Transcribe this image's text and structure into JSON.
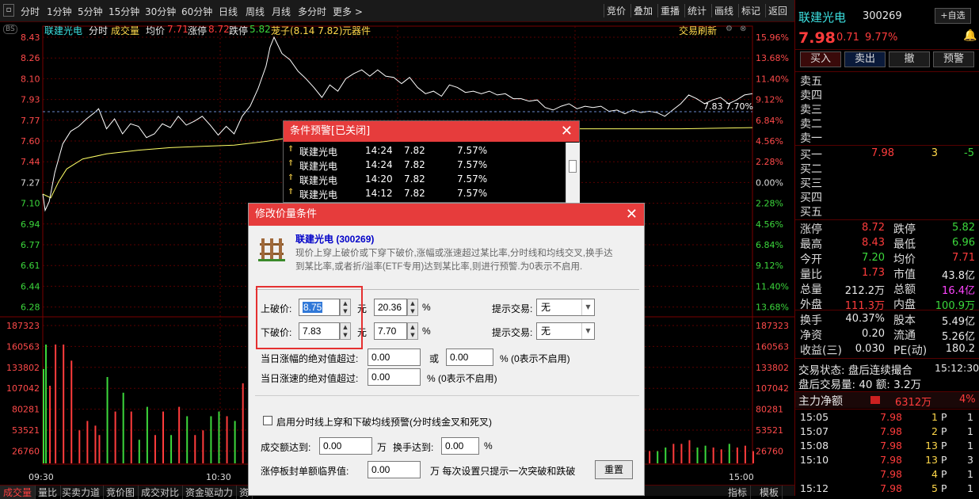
{
  "topbar": {
    "tabs": [
      "分时",
      "1分钟",
      "5分钟",
      "15分钟",
      "30分钟",
      "60分钟",
      "日线",
      "周线",
      "月线",
      "多分时",
      "更多 >"
    ],
    "active_tab": "分时",
    "right_buttons": [
      "竞价",
      "叠加",
      "重播",
      "统计",
      "画线",
      "标记",
      "返回"
    ]
  },
  "chart_header": {
    "name": "联建光电",
    "mode": "分时",
    "vol_label": "成交量",
    "avg_label": "均价",
    "avg_value": "7.71",
    "limit_up_label": "涨停",
    "limit_up": "8.72",
    "limit_down_label": "跌停",
    "limit_down": "5.82",
    "concept": "茏子(8.14 7.82)",
    "industry": "元器件",
    "refresh": "交易刷新"
  },
  "chart_data": {
    "type": "line",
    "price_ticks": [
      "8.43",
      "8.26",
      "8.10",
      "7.93",
      "7.77",
      "7.60",
      "7.44",
      "7.27",
      "7.10",
      "6.94",
      "6.77",
      "6.61",
      "6.44",
      "6.28"
    ],
    "pct_ticks": [
      "15.96%",
      "13.68%",
      "11.40%",
      "9.12%",
      "6.84%",
      "4.56%",
      "2.28%",
      "0.00%",
      "2.28%",
      "4.56%",
      "6.84%",
      "9.12%",
      "11.40%",
      "13.68%"
    ],
    "vol_ticks": [
      "187323",
      "160563",
      "133802",
      "107042",
      "80281",
      "53521",
      "26760"
    ],
    "time_ticks": [
      "09:30",
      "10:30",
      "15:00"
    ],
    "prev_close": 7.27,
    "alert_line_label": "7.83 7.70%",
    "series": [
      {
        "name": "分时",
        "color": "#ffffff",
        "points": [
          [
            0,
            7.18
          ],
          [
            3,
            7.05
          ],
          [
            8,
            7.12
          ],
          [
            15,
            7.35
          ],
          [
            25,
            7.58
          ],
          [
            35,
            7.68
          ],
          [
            45,
            7.72
          ],
          [
            55,
            7.78
          ],
          [
            65,
            7.83
          ],
          [
            70,
            7.86
          ],
          [
            80,
            7.7
          ],
          [
            90,
            7.78
          ],
          [
            100,
            7.66
          ],
          [
            110,
            7.74
          ],
          [
            120,
            7.72
          ],
          [
            130,
            7.63
          ],
          [
            140,
            7.66
          ],
          [
            150,
            7.74
          ],
          [
            160,
            7.71
          ],
          [
            170,
            7.8
          ],
          [
            180,
            7.73
          ],
          [
            190,
            7.76
          ],
          [
            200,
            7.8
          ],
          [
            210,
            7.73
          ],
          [
            220,
            7.65
          ],
          [
            230,
            7.72
          ],
          [
            240,
            7.66
          ],
          [
            250,
            7.8
          ],
          [
            260,
            7.88
          ],
          [
            270,
            8.02
          ],
          [
            280,
            8.2
          ],
          [
            285,
            8.35
          ],
          [
            290,
            8.43
          ],
          [
            300,
            8.3
          ],
          [
            310,
            8.25
          ],
          [
            320,
            8.16
          ],
          [
            330,
            8.1
          ],
          [
            340,
            8.03
          ],
          [
            350,
            7.95
          ],
          [
            360,
            8.05
          ],
          [
            370,
            8.0
          ],
          [
            380,
            8.1
          ],
          [
            390,
            8.14
          ],
          [
            400,
            8.17
          ],
          [
            410,
            8.12
          ],
          [
            420,
            8.17
          ],
          [
            430,
            8.12
          ],
          [
            440,
            8.11
          ],
          [
            450,
            8.06
          ],
          [
            460,
            8.11
          ],
          [
            470,
            8.03
          ],
          [
            480,
            7.98
          ],
          [
            490,
            8.0
          ],
          [
            500,
            7.96
          ],
          [
            510,
            8.05
          ],
          [
            520,
            8.03
          ],
          [
            530,
            7.99
          ],
          [
            540,
            8.0
          ],
          [
            550,
            7.98
          ],
          [
            560,
            8.0
          ],
          [
            570,
            7.97
          ],
          [
            580,
            7.98
          ],
          [
            590,
            7.94
          ],
          [
            600,
            7.94
          ],
          [
            610,
            7.92
          ],
          [
            620,
            7.93
          ],
          [
            630,
            7.87
          ],
          [
            640,
            7.85
          ],
          [
            650,
            7.88
          ],
          [
            660,
            7.9
          ],
          [
            670,
            7.86
          ],
          [
            680,
            7.88
          ],
          [
            690,
            7.87
          ],
          [
            700,
            7.88
          ],
          [
            710,
            7.84
          ],
          [
            720,
            7.85
          ],
          [
            730,
            7.82
          ],
          [
            740,
            7.85
          ],
          [
            750,
            7.83
          ],
          [
            760,
            7.84
          ],
          [
            770,
            7.83
          ],
          [
            780,
            7.8
          ],
          [
            790,
            7.85
          ],
          [
            800,
            7.9
          ],
          [
            810,
            7.97
          ],
          [
            820,
            7.94
          ],
          [
            830,
            7.9
          ],
          [
            840,
            7.93
          ],
          [
            850,
            7.95
          ],
          [
            860,
            7.9
          ],
          [
            870,
            7.93
          ],
          [
            880,
            7.97
          ],
          [
            890,
            7.98
          ]
        ]
      },
      {
        "name": "均价",
        "color": "#ffff66",
        "points": [
          [
            0,
            7.18
          ],
          [
            10,
            7.15
          ],
          [
            20,
            7.28
          ],
          [
            30,
            7.38
          ],
          [
            50,
            7.46
          ],
          [
            80,
            7.5
          ],
          [
            120,
            7.53
          ],
          [
            160,
            7.55
          ],
          [
            200,
            7.56
          ],
          [
            240,
            7.57
          ],
          [
            280,
            7.6
          ],
          [
            320,
            7.64
          ],
          [
            360,
            7.66
          ],
          [
            400,
            7.68
          ],
          [
            450,
            7.69
          ],
          [
            500,
            7.7
          ],
          [
            550,
            7.7
          ],
          [
            600,
            7.7
          ],
          [
            700,
            7.7
          ],
          [
            800,
            7.7
          ],
          [
            890,
            7.71
          ]
        ]
      }
    ]
  },
  "bottombar": {
    "tabs": [
      "成交量",
      "量比",
      "买卖力道",
      "竞价图",
      "成交对比",
      "资金驱动力",
      "资"
    ],
    "right": [
      "指标",
      "模板"
    ]
  },
  "quote": {
    "name": "联建光电",
    "code": "300269",
    "self_select": "+自选",
    "price": "7.98",
    "change": "0.71",
    "change_pct": "9.77%",
    "buttons": [
      "买入",
      "卖出",
      "撤",
      "预警"
    ],
    "sells": [
      "卖五",
      "卖四",
      "卖三",
      "卖二",
      "卖一"
    ],
    "buys": [
      {
        "label": "买一",
        "price": "7.98",
        "vol": "3",
        "diff": "-5"
      },
      {
        "label": "买二",
        "price": "",
        "vol": "",
        "diff": ""
      },
      {
        "label": "买三",
        "price": "",
        "vol": "",
        "diff": ""
      },
      {
        "label": "买四",
        "price": "",
        "vol": "",
        "diff": ""
      },
      {
        "label": "买五",
        "price": "",
        "vol": "",
        "diff": ""
      }
    ],
    "stats": [
      {
        "l1": "涨停",
        "v1": "8.72",
        "c1": "red",
        "l2": "跌停",
        "v2": "5.82",
        "c2": "grn"
      },
      {
        "l1": "最高",
        "v1": "8.43",
        "c1": "red",
        "l2": "最低",
        "v2": "6.96",
        "c2": "grn"
      },
      {
        "l1": "今开",
        "v1": "7.20",
        "c1": "grn",
        "l2": "均价",
        "v2": "7.71",
        "c2": "red"
      },
      {
        "l1": "量比",
        "v1": "1.73",
        "c1": "red",
        "l2": "市值",
        "v2": "43.8亿",
        "c2": "wht"
      },
      {
        "l1": "总量",
        "v1": "212.2万",
        "c1": "wht",
        "l2": "总额",
        "v2": "16.4亿",
        "c2": "mag"
      },
      {
        "l1": "外盘",
        "v1": "111.3万",
        "c1": "red",
        "l2": "内盘",
        "v2": "100.9万",
        "c2": "grn"
      }
    ],
    "stats2": [
      {
        "l1": "换手",
        "v1": "40.37%",
        "l2": "股本",
        "v2": "5.49亿"
      },
      {
        "l1": "净资",
        "v1": "0.20",
        "l2": "流通",
        "v2": "5.26亿"
      },
      {
        "l1": "收益(三)",
        "v1": "0.030",
        "l2": "PE(动)",
        "v2": "180.2"
      }
    ],
    "trade_status": "交易状态: 盘后连续撮合",
    "trade_time": "15:12:30",
    "after_hours": "盘后交易量: 40  额: 3.2万",
    "main_flow_label": "主力净额",
    "main_flow_value": "6312万",
    "main_flow_pct": "4%",
    "ticks": [
      {
        "time": "15:05",
        "price": "7.98",
        "vol": "1",
        "type": "P",
        "n": "1"
      },
      {
        "time": "15:07",
        "price": "7.98",
        "vol": "2",
        "type": "P",
        "n": "1"
      },
      {
        "time": "15:08",
        "price": "7.98",
        "vol": "13",
        "type": "P",
        "n": "1"
      },
      {
        "time": "15:10",
        "price": "7.98",
        "vol": "13",
        "type": "P",
        "n": "3"
      },
      {
        "time": "",
        "price": "7.98",
        "vol": "4",
        "type": "P",
        "n": "1"
      },
      {
        "time": "15:12",
        "price": "7.98",
        "vol": "5",
        "type": "P",
        "n": "1"
      }
    ]
  },
  "alert_window": {
    "title": "条件预警[已关闭]",
    "rows": [
      {
        "name": "联建光电",
        "time": "14:24",
        "price": "7.82",
        "pct": "7.57%"
      },
      {
        "name": "联建光电",
        "time": "14:24",
        "price": "7.82",
        "pct": "7.57%"
      },
      {
        "name": "联建光电",
        "time": "14:20",
        "price": "7.82",
        "pct": "7.57%"
      },
      {
        "name": "联建光电",
        "time": "14:12",
        "price": "7.82",
        "pct": "7.57%"
      }
    ]
  },
  "dialog": {
    "title": "修改价量条件",
    "stock": "联建光电 (300269)",
    "desc": "现价上穿上破价或下穿下破价,涨幅或涨速超过某比率,分时线和均线交叉,换手达到某比率,或者折/溢率(ETF专用)达到某比率,则进行预警.为0表示不启用.",
    "upper_label": "上破价:",
    "upper_value": "8.75",
    "upper_pct": "20.36",
    "lower_label": "下破价:",
    "lower_value": "7.83",
    "lower_pct": "7.70",
    "yuan": "元",
    "pct_sign": "%",
    "hint_label": "提示交易:",
    "hint_value": "无",
    "amp_label": "当日涨幅的绝对值超过:",
    "amp_value1": "0.00",
    "or": "或",
    "amp_value2": "0.00",
    "amp_note": "% (0表示不启用)",
    "speed_label": "当日涨速的绝对值超过:",
    "speed_value": "0.00",
    "speed_note": "% (0表示不启用)",
    "cross_label": "启用分时线上穿和下破均线预警(分时线金叉和死叉)",
    "amount_label": "成交额达到:",
    "amount_value": "0.00",
    "wan": "万",
    "turnover_label": "换手达到:",
    "turnover_value": "0.00",
    "seal_label": "涨停板封单额临界值:",
    "seal_value": "0.00",
    "seal_note": "万 每次设置只提示一次突破和跌破",
    "reset": "重置"
  }
}
